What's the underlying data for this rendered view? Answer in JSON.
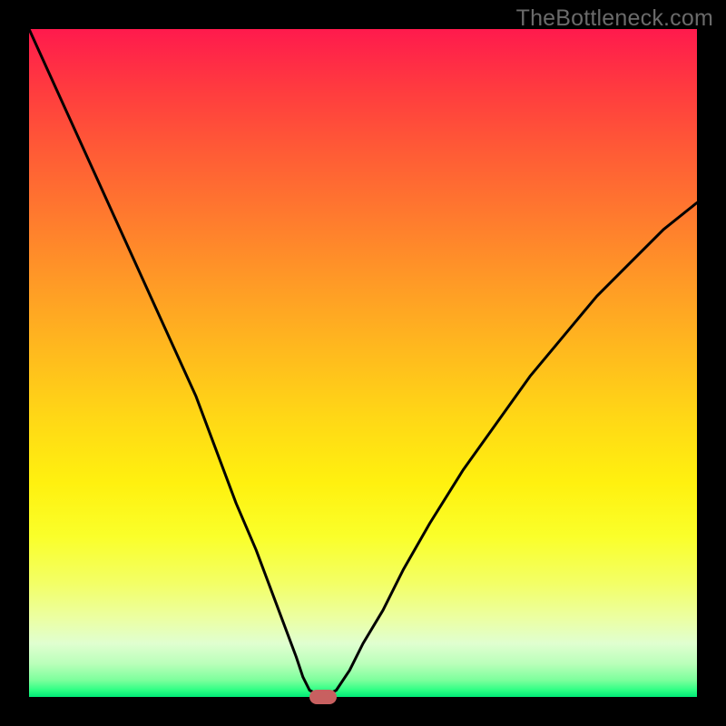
{
  "watermark": "TheBottleneck.com",
  "chart_data": {
    "type": "line",
    "title": "",
    "xlabel": "",
    "ylabel": "",
    "xlim": [
      0,
      100
    ],
    "ylim": [
      0,
      100
    ],
    "series": [
      {
        "name": "curve",
        "x": [
          0,
          5,
          10,
          15,
          20,
          25,
          28,
          31,
          34,
          37,
          40,
          41,
          42,
          44,
          46,
          48,
          50,
          53,
          56,
          60,
          65,
          70,
          75,
          80,
          85,
          90,
          95,
          100
        ],
        "values": [
          100,
          89,
          78,
          67,
          56,
          45,
          37,
          29,
          22,
          14,
          6,
          3,
          1,
          0,
          1,
          4,
          8,
          13,
          19,
          26,
          34,
          41,
          48,
          54,
          60,
          65,
          70,
          74
        ]
      }
    ],
    "marker": {
      "x": 44,
      "y": 0
    },
    "gradient": {
      "top": "#ff1a4d",
      "mid": "#ffe000",
      "bottom": "#00e876"
    }
  }
}
